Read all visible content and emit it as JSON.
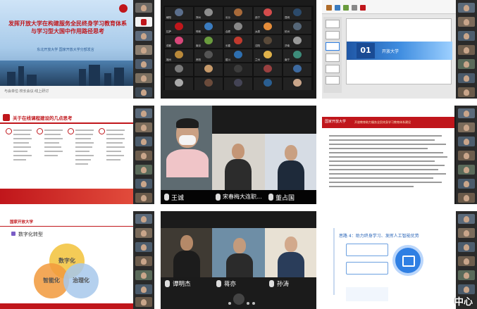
{
  "tiles": {
    "t1": {
      "slide_title": "发挥开放大学在构建服务全民终身学习教育体系与学习型大国中作用路径思考",
      "slide_sub": "东北开放大学 国家开放大学分部发言",
      "bottom_text": "与会单位·校长会议·线上研讨"
    },
    "t2": {
      "participants": [
        "朝阳",
        "郑州",
        "长沙",
        "西宁",
        "昆明",
        "拉萨",
        "呼和",
        "合肥",
        "太原",
        "杭州",
        "成都",
        "南京",
        "长春",
        "沈阳",
        "济南",
        "福州",
        "贵阳",
        "银川",
        "兰州",
        "南宁"
      ]
    },
    "t3": {
      "section_number": "01",
      "section_title": "开放大学"
    },
    "t4": {
      "heading": "关于在线课程建设的几点思考"
    },
    "t5": {
      "names": [
        "王诚",
        "宋春梅大连职...",
        "董占国"
      ]
    },
    "t6": {
      "logo_text": "国家开放大学",
      "header_text": "开放教育助力服务全民终身学习教育体系建设"
    },
    "t7": {
      "header": "国家开放大学",
      "section": "数字化转型",
      "circles": [
        "数字化",
        "智能化",
        "治理化"
      ]
    },
    "t8": {
      "names": [
        "谭明杰",
        "蒋亦",
        "孙涛"
      ]
    },
    "t9": {
      "heading": "思路 4：助力终身学习、发挥人工智能优势"
    }
  },
  "watermark": "中心",
  "colors": {
    "brand_red": "#c0161b",
    "blue": "#2f7fe3"
  }
}
